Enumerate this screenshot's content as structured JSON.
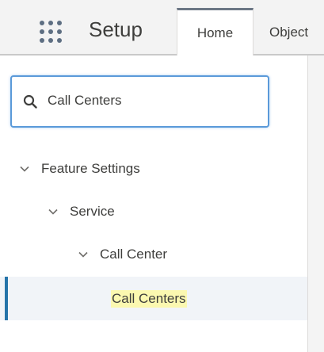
{
  "header": {
    "app_name": "Setup",
    "tabs": [
      {
        "label": "Home",
        "active": true
      },
      {
        "label": "Object"
      }
    ]
  },
  "sidebar": {
    "search": {
      "value": "Call Centers",
      "icon": "search-icon"
    },
    "tree": [
      {
        "label": "Feature Settings",
        "level": 0,
        "expanded": true
      },
      {
        "label": "Service",
        "level": 1,
        "expanded": true
      },
      {
        "label": "Call Center",
        "level": 2,
        "expanded": true
      },
      {
        "label": "Call Centers",
        "level": 3,
        "selected": true,
        "highlighted": true
      }
    ]
  },
  "colors": {
    "selection_bar": "#2574a9",
    "search_focus": "#5b9ad9",
    "match_highlight": "#fbf8b0"
  }
}
